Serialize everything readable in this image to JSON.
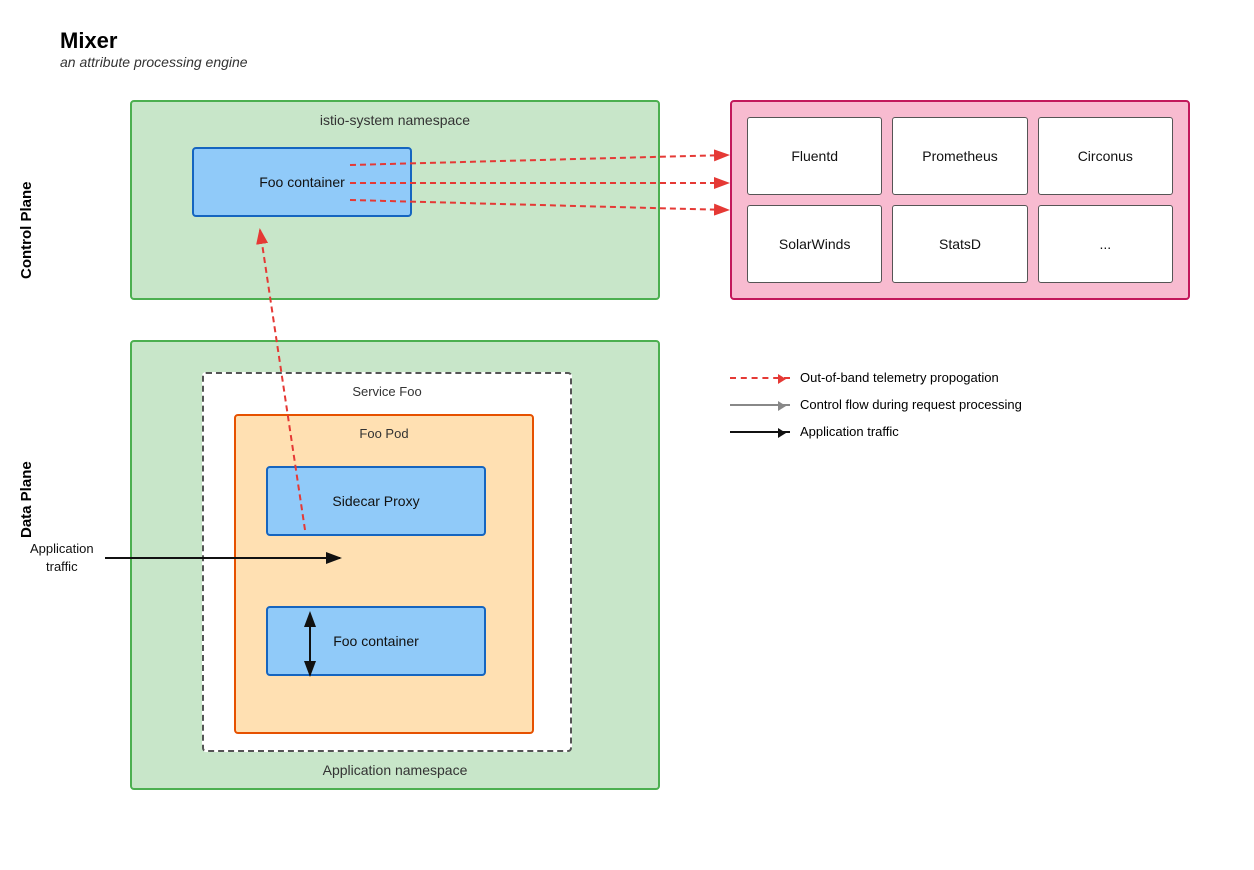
{
  "title": {
    "main": "Mixer",
    "sub": "an attribute processing engine"
  },
  "planes": {
    "control": "Control Plane",
    "data": "Data Plane"
  },
  "control_plane": {
    "namespace": "istio-system namespace",
    "foo_container": "Foo container"
  },
  "data_plane": {
    "namespace": "Application namespace",
    "service_foo": "Service Foo",
    "foo_pod": "Foo Pod",
    "sidecar_proxy": "Sidecar Proxy",
    "foo_container": "Foo container"
  },
  "backends": {
    "items": [
      "Fluentd",
      "Prometheus",
      "Circonus",
      "SolarWinds",
      "StatsD",
      "..."
    ]
  },
  "legend": {
    "items": [
      {
        "label": "Out-of-band telemetry propogation",
        "type": "dashed-red"
      },
      {
        "label": "Control flow during request processing",
        "type": "solid-gray"
      },
      {
        "label": "Application traffic",
        "type": "solid-black"
      }
    ]
  },
  "app_traffic_label": "Application\ntraffic"
}
